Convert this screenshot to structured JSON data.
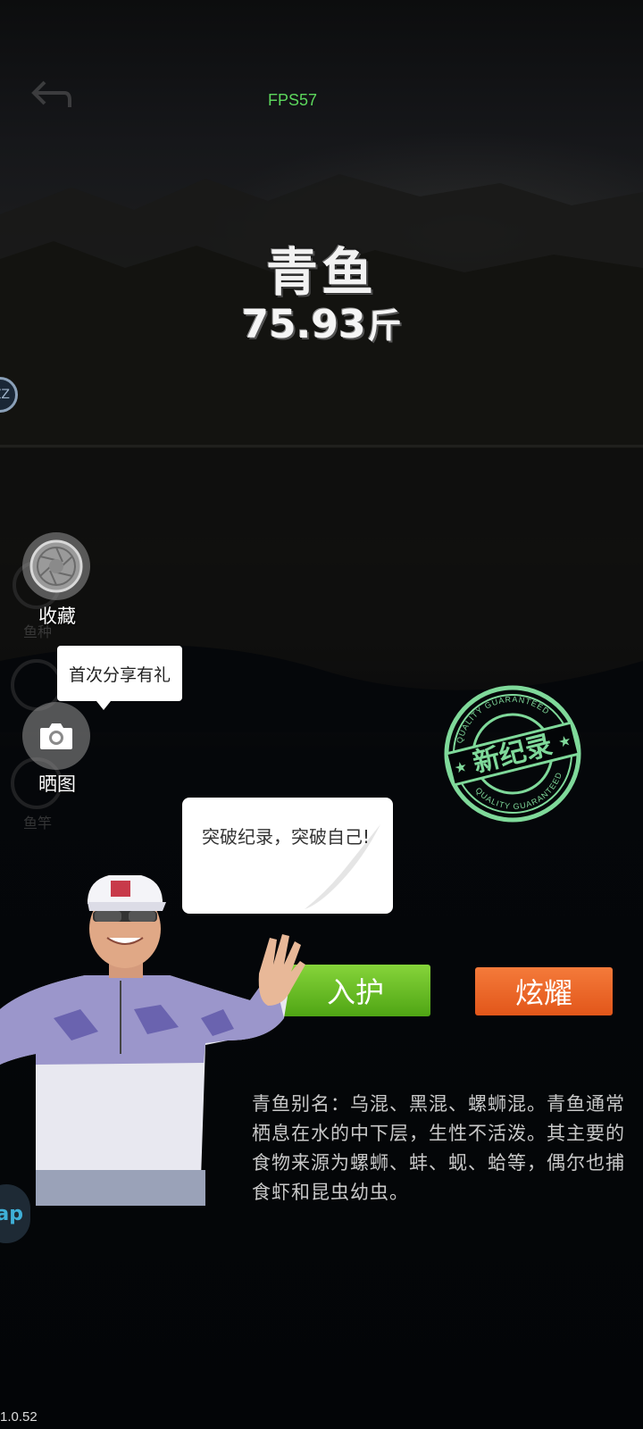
{
  "hud": {
    "fps": "FPS57",
    "version": "1.0.52"
  },
  "catch": {
    "fish_name": "青鱼",
    "weight": "75.93",
    "unit": "斤"
  },
  "side": {
    "circle_text": "ZZ",
    "left_pill_text": "ap"
  },
  "ghost": {
    "label_1": "鱼种",
    "label_2": "鱼竿"
  },
  "buttons": {
    "collect_label": "收藏",
    "share_label": "晒图",
    "protect_label": "入护",
    "show_label": "炫耀"
  },
  "share_tip": "首次分享有礼",
  "speech": "突破纪录，突破自己!",
  "stamp": {
    "text": "新纪录",
    "ring_text": "QUALITY GUARANTEED"
  },
  "description": "青鱼别名：乌混、黑混、螺蛳混。青鱼通常栖息在水的中下层，生性不活泼。其主要的食物来源为螺蛳、蚌、蚬、蛤等，偶尔也捕食虾和昆虫幼虫。",
  "colors": {
    "protect": "#5cb51e",
    "show": "#ea6426",
    "fps": "#5cd65c",
    "stamp": "#7fd99a"
  }
}
